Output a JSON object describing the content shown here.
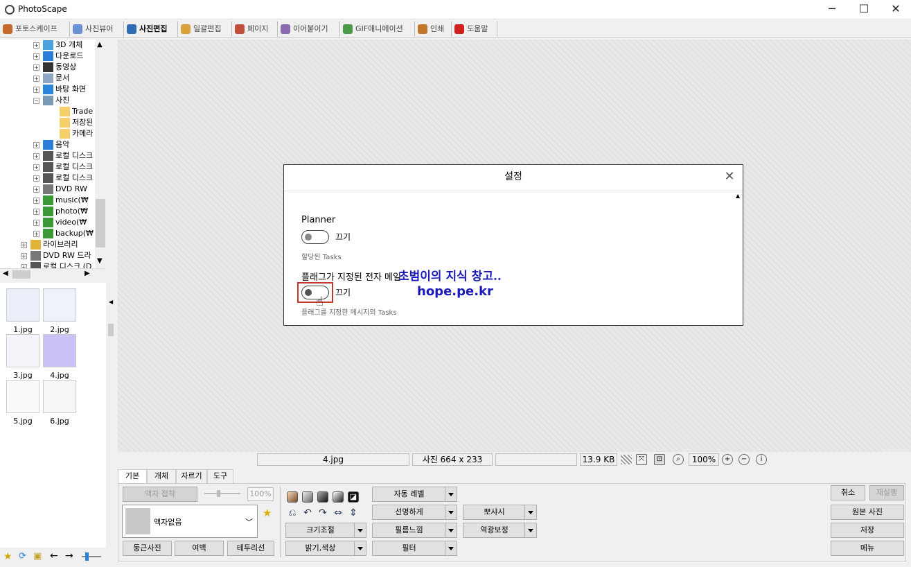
{
  "window": {
    "title": "PhotoScape"
  },
  "window_controls": {
    "minimize": "─",
    "maximize": "☐",
    "close": "✕"
  },
  "tabs": [
    {
      "label": "포토스케이프",
      "icon": "photoscape-icon",
      "color": "#c46a2b"
    },
    {
      "label": "사진뷰어",
      "icon": "viewer-icon",
      "color": "#6a8fd4"
    },
    {
      "label": "사진편집",
      "icon": "editor-icon",
      "color": "#2f6db5",
      "active": true
    },
    {
      "label": "일괄편집",
      "icon": "batch-icon",
      "color": "#d9a23a"
    },
    {
      "label": "페이지",
      "icon": "page-icon",
      "color": "#c0503a"
    },
    {
      "label": "이어붙이기",
      "icon": "combine-icon",
      "color": "#8a6bb0"
    },
    {
      "label": "GIF애니메이션",
      "icon": "gif-icon",
      "color": "#4a9a4a"
    },
    {
      "label": "인쇄",
      "icon": "print-icon",
      "color": "#c4762b"
    },
    {
      "label": "도움말",
      "icon": "help-icon",
      "color": "#d12020"
    }
  ],
  "tree": [
    {
      "label": "3D 개체",
      "icon": "3d-objects-icon",
      "color": "#4aa3df"
    },
    {
      "label": "다운로드",
      "icon": "download-icon",
      "color": "#2b7fd9"
    },
    {
      "label": "동영상",
      "icon": "video-folder-icon",
      "color": "#333"
    },
    {
      "label": "문서",
      "icon": "documents-icon",
      "color": "#8fa7c4"
    },
    {
      "label": "바탕 화면",
      "icon": "desktop-icon",
      "color": "#2b86d9"
    },
    {
      "label": "사진",
      "icon": "pictures-icon",
      "color": "#7a9ab8"
    },
    {
      "label": "Trade",
      "icon": "folder-icon",
      "color": "#f5cf6a",
      "child": true
    },
    {
      "label": "저장된",
      "icon": "folder-icon",
      "color": "#f5cf6a",
      "child": true
    },
    {
      "label": "카메라",
      "icon": "folder-icon",
      "color": "#f5cf6a",
      "child": true
    },
    {
      "label": "음악",
      "icon": "music-icon",
      "color": "#2b7fd9"
    },
    {
      "label": "로컬 디스크",
      "icon": "disk-icon",
      "color": "#555"
    },
    {
      "label": "로컬 디스크",
      "icon": "disk-icon",
      "color": "#555"
    },
    {
      "label": "로컬 디스크",
      "icon": "disk-icon",
      "color": "#555"
    },
    {
      "label": "DVD RW",
      "icon": "dvd-icon",
      "color": "#777"
    },
    {
      "label": "music(₩",
      "icon": "network-drive-icon",
      "color": "#3a9a3a"
    },
    {
      "label": "photo(₩",
      "icon": "network-drive-icon",
      "color": "#3a9a3a"
    },
    {
      "label": "video(₩",
      "icon": "network-drive-icon",
      "color": "#3a9a3a"
    },
    {
      "label": "backup(₩",
      "icon": "network-drive-icon",
      "color": "#3a9a3a"
    },
    {
      "label": "라이브러리",
      "icon": "library-icon",
      "color": "#e0b33a",
      "top": true
    },
    {
      "label": "DVD RW 드라",
      "icon": "dvd-icon",
      "color": "#777",
      "top": true
    },
    {
      "label": "로컬 디스크 (D",
      "icon": "disk-icon",
      "color": "#555",
      "top": true
    }
  ],
  "thumbnails": [
    {
      "label": "1.jpg",
      "tint": "#e9eef8"
    },
    {
      "label": "2.jpg",
      "tint": "#eef2fa"
    },
    {
      "label": "3.jpg",
      "tint": "#f3f5fb"
    },
    {
      "label": "4.jpg",
      "tint": "#c8c2f5"
    },
    {
      "label": "5.jpg",
      "tint": "#fafafa"
    },
    {
      "label": "6.jpg",
      "tint": "#f7f7f7"
    }
  ],
  "dialog": {
    "title": "설정",
    "close": "✕",
    "section1": {
      "heading": "Planner",
      "toggle_label": "끄기",
      "sub": "할당된 Tasks"
    },
    "section2": {
      "heading": "플래그가 지정된 전자 메일",
      "toggle_label": "끄기",
      "sub": "플래그를 지정한 메시지의 Tasks"
    },
    "watermark_line1": "초범이의 지식 창고..",
    "watermark_line2": "hope.pe.kr"
  },
  "status": {
    "filename": "4.jpg",
    "dimensions": "사진 664 x 233",
    "empty": "",
    "filesize": "13.9 KB",
    "zoom": "100%"
  },
  "subtabs": [
    "기본",
    "개체",
    "자르기",
    "도구"
  ],
  "panel": {
    "frame_paste": "액자 접착",
    "percent": "100%",
    "frame_select": "액자없음",
    "round_photo": "둥근사진",
    "margin": "여백",
    "border": "테두리선",
    "auto_level": "자동 레벨",
    "sharpen": "선명하게",
    "film_feel": "필름느낌",
    "filter": "필터",
    "resize": "크기조절",
    "brightness": "밝기,색상",
    "bokeh": "뽀샤시",
    "backlight": "역광보정",
    "cancel": "취소",
    "redo": "재실행",
    "original": "원본 사진",
    "save": "저장",
    "menu": "메뉴"
  },
  "colors": {
    "accent": "#c0392b",
    "watermark": "#1a1ab8",
    "active_tab": "#000000"
  }
}
